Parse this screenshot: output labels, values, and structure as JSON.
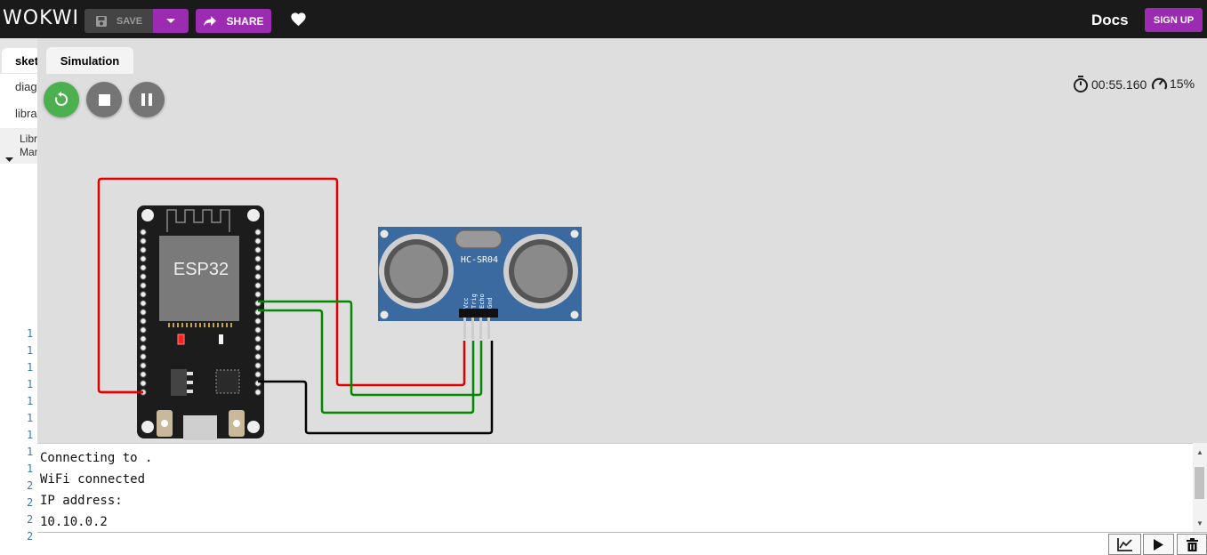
{
  "app": {
    "logo": "WOKWI"
  },
  "header": {
    "save_label": "SAVE",
    "share_label": "SHARE",
    "docs_label": "Docs",
    "signup_label": "SIGN UP"
  },
  "left_panel": {
    "active_tab": "sketch",
    "files": [
      "diagram.json",
      "libraries.txt"
    ],
    "library_manager": "Library Manager",
    "line_numbers": [
      "1",
      "1",
      "1",
      "1",
      "1",
      "1",
      "1",
      "1",
      "1",
      "2",
      "2",
      "2",
      "2"
    ]
  },
  "simulation": {
    "tab_label": "Simulation",
    "timer": "00:55.160",
    "speed": "15%",
    "esp32_label": "ESP32",
    "sensor_label": "HC-SR04",
    "sensor_pins": [
      "Vcc",
      "Trig",
      "Echo",
      "Gnd"
    ],
    "controls": [
      "restart-button",
      "stop-button",
      "pause-button"
    ]
  },
  "console": {
    "lines": [
      "Connecting to .",
      "WiFi connected",
      "IP address:",
      "10.10.0.2"
    ]
  },
  "colors": {
    "accent": "#9b2bb0",
    "restart": "#4caf50",
    "wire_red": "#e00000",
    "wire_green": "#008800",
    "wire_black": "#000000"
  }
}
